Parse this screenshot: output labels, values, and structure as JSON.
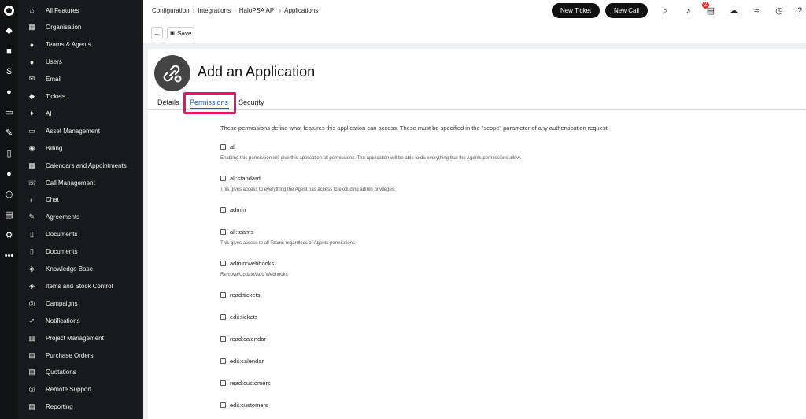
{
  "sidebar": {
    "items": [
      {
        "label": "All Features",
        "icon": "home-icon"
      },
      {
        "label": "Organisation",
        "icon": "grid-icon"
      },
      {
        "label": "Teams & Agents",
        "icon": "user-icon"
      },
      {
        "label": "Users",
        "icon": "user-icon"
      },
      {
        "label": "Email",
        "icon": "mail-icon"
      },
      {
        "label": "Tickets",
        "icon": "ticket-icon"
      },
      {
        "label": "AI",
        "icon": "sparkle-icon"
      },
      {
        "label": "Asset Management",
        "icon": "laptop-icon"
      },
      {
        "label": "Billing",
        "icon": "money-bag-icon"
      },
      {
        "label": "Calendars and Appointments",
        "icon": "calendar-icon"
      },
      {
        "label": "Call Management",
        "icon": "phone-icon"
      },
      {
        "label": "Chat",
        "icon": "chat-icon"
      },
      {
        "label": "Agreements",
        "icon": "agreement-icon"
      },
      {
        "label": "Documents",
        "icon": "document-icon"
      },
      {
        "label": "Documents",
        "icon": "documents-icon"
      },
      {
        "label": "Knowledge Base",
        "icon": "box-icon"
      },
      {
        "label": "Items and Stock Control",
        "icon": "stock-icon"
      },
      {
        "label": "Campaigns",
        "icon": "campaign-icon"
      },
      {
        "label": "Notifications",
        "icon": "rocket-icon"
      },
      {
        "label": "Project Management",
        "icon": "project-icon"
      },
      {
        "label": "Purchase Orders",
        "icon": "purchase-order-icon"
      },
      {
        "label": "Quotations",
        "icon": "quote-icon"
      },
      {
        "label": "Remote Support",
        "icon": "remote-icon"
      },
      {
        "label": "Reporting",
        "icon": "report-icon"
      }
    ]
  },
  "topbar": {
    "breadcrumb": [
      "Configuration",
      "Integrations",
      "HaloPSA API",
      "Applications"
    ],
    "new_ticket": "New Ticket",
    "new_call": "New Call",
    "notification_count": "2"
  },
  "toolbar": {
    "back_label": "←",
    "save_label": "Save"
  },
  "page": {
    "title": "Add an Application",
    "tabs": [
      "Details",
      "Permissions",
      "Security"
    ],
    "active_tab": "Permissions",
    "intro": "These permissions define what features this application can access. These must be specified in the \"scope\" parameter of any authentication request."
  },
  "permissions": [
    {
      "name": "all",
      "desc": "Enabling this permission will give this application all permissions. The application will be able to do everything that the Agents permissions allow.",
      "checked": false
    },
    {
      "name": "all:standard",
      "desc": "This gives access to everything the Agent has access to excluding admin privileges.",
      "checked": false
    },
    {
      "name": "admin",
      "desc": "",
      "checked": false
    },
    {
      "name": "all:teams",
      "desc": "This gives access to all Teams regardless of Agents permissions",
      "checked": false
    },
    {
      "name": "admin:webhooks",
      "desc": "Remove/Update/Add Webhooks",
      "checked": false
    },
    {
      "name": "read:tickets",
      "desc": "",
      "checked": false
    },
    {
      "name": "edit:tickets",
      "desc": "",
      "checked": false
    },
    {
      "name": "read:calendar",
      "desc": "",
      "checked": false
    },
    {
      "name": "edit:calendar",
      "desc": "",
      "checked": false
    },
    {
      "name": "read:customers",
      "desc": "",
      "checked": false
    },
    {
      "name": "edit:customers",
      "desc": "",
      "checked": false
    }
  ],
  "colors": {
    "accent": "#2b5ea7",
    "highlight": "#e8146a",
    "sidebar": "#18191c"
  }
}
